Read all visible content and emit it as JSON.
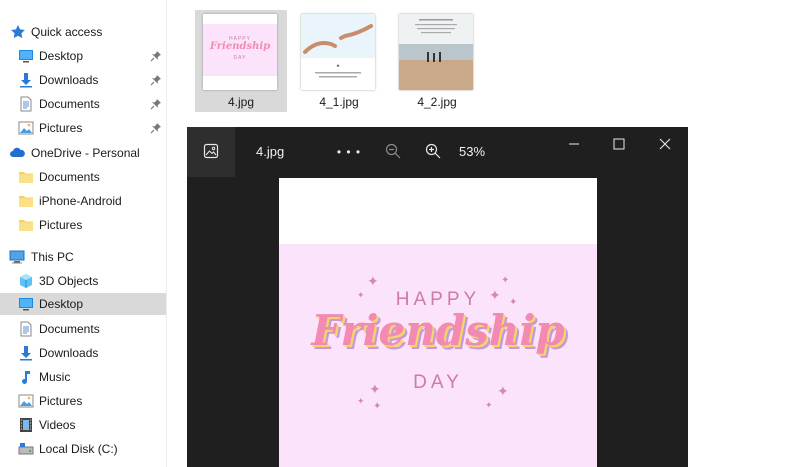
{
  "sidebar": {
    "quick_access": "Quick access",
    "qa_items": [
      {
        "label": "Desktop"
      },
      {
        "label": "Downloads"
      },
      {
        "label": "Documents"
      },
      {
        "label": "Pictures"
      }
    ],
    "onedrive": "OneDrive - Personal",
    "od_items": [
      {
        "label": "Documents"
      },
      {
        "label": "iPhone-Android"
      },
      {
        "label": "Pictures"
      }
    ],
    "this_pc": "This PC",
    "pc_items": [
      {
        "label": "3D Objects"
      },
      {
        "label": "Desktop"
      },
      {
        "label": "Documents"
      },
      {
        "label": "Downloads"
      },
      {
        "label": "Music"
      },
      {
        "label": "Pictures"
      },
      {
        "label": "Videos"
      },
      {
        "label": "Local Disk (C:)"
      }
    ]
  },
  "files": [
    {
      "name": "4.jpg"
    },
    {
      "name": "4_1.jpg"
    },
    {
      "name": "4_2.jpg"
    }
  ],
  "viewer": {
    "filename": "4.jpg",
    "more": "• • •",
    "zoom": "53%"
  },
  "image": {
    "happy": "HAPPY",
    "friendship": "Friendship",
    "day": "DAY"
  },
  "thumb_text": {
    "happy_small": "HAPPY",
    "friendship_small": "Friendship",
    "day_small": "DAY"
  },
  "colors": {
    "selected_bg": "#d9d9d9",
    "viewer_bg": "#1f1f1f",
    "card_pink": "#fbe4fb",
    "friendship_pink": "#f28ab2"
  }
}
